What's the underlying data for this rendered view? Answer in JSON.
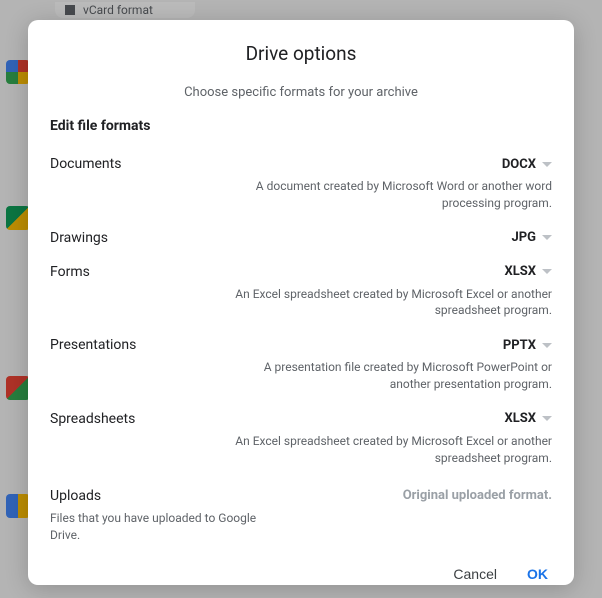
{
  "background": {
    "chip_label": "vCard format"
  },
  "dialog": {
    "title": "Drive options",
    "subtitle": "Choose specific formats for your archive",
    "section_heading": "Edit file formats",
    "rows": {
      "documents": {
        "label": "Documents",
        "value": "DOCX",
        "desc": "A document created by Microsoft Word or another word processing program."
      },
      "drawings": {
        "label": "Drawings",
        "value": "JPG",
        "desc": ""
      },
      "forms": {
        "label": "Forms",
        "value": "XLSX",
        "desc": "An Excel spreadsheet created by Microsoft Excel or another spreadsheet program."
      },
      "presentations": {
        "label": "Presentations",
        "value": "PPTX",
        "desc": "A presentation file created by Microsoft PowerPoint or another presentation program."
      },
      "spreadsheets": {
        "label": "Spreadsheets",
        "value": "XLSX",
        "desc": "An Excel spreadsheet created by Microsoft Excel or another spreadsheet program."
      }
    },
    "uploads": {
      "label": "Uploads",
      "sub": "Files that you have uploaded to Google Drive.",
      "right": "Original uploaded format."
    },
    "actions": {
      "cancel": "Cancel",
      "ok": "OK"
    }
  }
}
